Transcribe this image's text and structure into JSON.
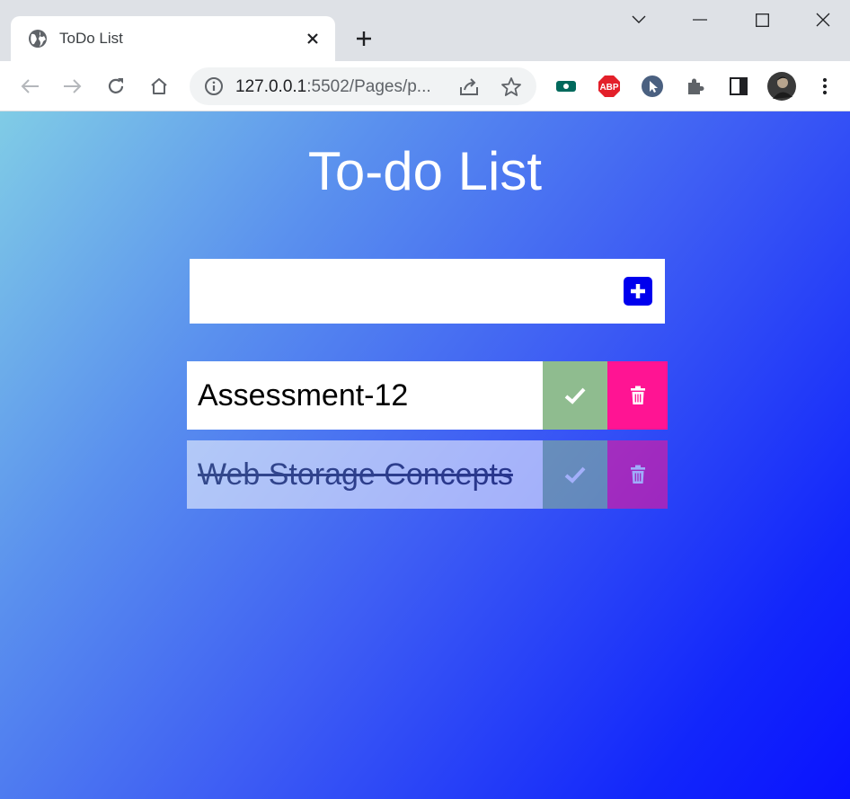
{
  "browser": {
    "tab_title": "ToDo List",
    "url_host": "127.0.0.1",
    "url_rest": ":5502/Pages/p...",
    "ext_abp_label": "ABP"
  },
  "app": {
    "title": "To-do List",
    "input_value": "",
    "input_placeholder": "",
    "todos": [
      {
        "text": "Assessment-12",
        "completed": false
      },
      {
        "text": "Web Storage Concepts",
        "completed": true
      }
    ]
  },
  "colors": {
    "add_button": "#0000ee",
    "check_button": "#8fbc8f",
    "delete_button": "#ff1493"
  }
}
